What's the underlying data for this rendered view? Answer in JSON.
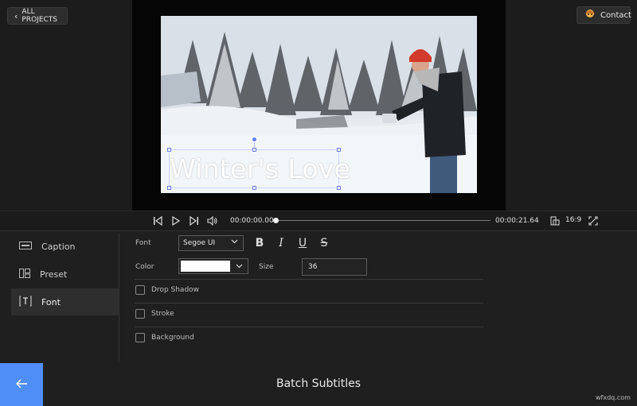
{
  "header": {
    "all_projects_label": "ALL PROJECTS",
    "contact_label": "Contact"
  },
  "preview": {
    "caption_text": "Winter's Love"
  },
  "playback": {
    "current_time": "00:00:00.00",
    "total_time": "00:00:21.64",
    "aspect_ratio": "16:9",
    "progress_fraction": 0.0
  },
  "sidebar": {
    "items": [
      {
        "label": "Caption",
        "icon": "caption-icon"
      },
      {
        "label": "Preset",
        "icon": "preset-icon"
      },
      {
        "label": "Font",
        "icon": "font-icon",
        "active": true
      }
    ]
  },
  "font_panel": {
    "font_label": "Font",
    "font_value": "Segoe UI",
    "color_label": "Color",
    "color_value": "#ffffff",
    "size_label": "Size",
    "size_value": "36",
    "format_buttons": [
      "B",
      "I",
      "U",
      "S"
    ],
    "options": [
      {
        "label": "Drop Shadow",
        "checked": false
      },
      {
        "label": "Stroke",
        "checked": false
      },
      {
        "label": "Background",
        "checked": false
      }
    ]
  },
  "footer": {
    "title": "Batch Subtitles",
    "watermark": "wfxdq.com"
  },
  "colors": {
    "accent": "#4f8ef7",
    "panel_bg": "#1f1f1f"
  }
}
